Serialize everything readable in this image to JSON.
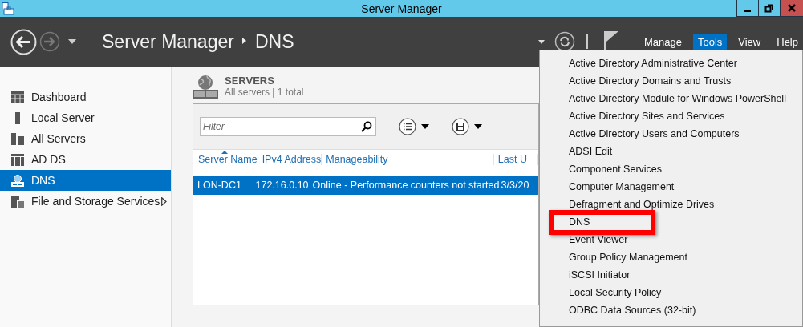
{
  "window": {
    "title": "Server Manager"
  },
  "header": {
    "breadcrumb": [
      {
        "label": "Server Manager"
      },
      {
        "label": "DNS"
      }
    ],
    "menus": [
      {
        "label": "Manage",
        "selected": false
      },
      {
        "label": "Tools",
        "selected": true
      },
      {
        "label": "View",
        "selected": false
      },
      {
        "label": "Help",
        "selected": false
      }
    ]
  },
  "sidebar": {
    "items": [
      {
        "label": "Dashboard",
        "selected": false,
        "has_submenu": false
      },
      {
        "label": "Local Server",
        "selected": false,
        "has_submenu": false
      },
      {
        "label": "All Servers",
        "selected": false,
        "has_submenu": false
      },
      {
        "label": "AD DS",
        "selected": false,
        "has_submenu": false
      },
      {
        "label": "DNS",
        "selected": true,
        "has_submenu": false
      },
      {
        "label": "File and Storage Services",
        "selected": false,
        "has_submenu": true
      }
    ]
  },
  "servers": {
    "title": "SERVERS",
    "subtitle": "All servers | 1 total",
    "filter": {
      "placeholder": "Filter"
    },
    "table": {
      "columns": [
        "Server Name",
        "IPv4 Address",
        "Manageability",
        "Last U"
      ],
      "rows": [
        {
          "cells": [
            "LON-DC1",
            "172.16.0.10",
            "Online - Performance counters not started",
            "3/3/20"
          ],
          "selected": true
        }
      ]
    }
  },
  "tools_menu": {
    "items": [
      {
        "label": "Active Directory Administrative Center",
        "highlighted": false
      },
      {
        "label": "Active Directory Domains and Trusts",
        "highlighted": false
      },
      {
        "label": "Active Directory Module for Windows PowerShell",
        "highlighted": false
      },
      {
        "label": "Active Directory Sites and Services",
        "highlighted": false
      },
      {
        "label": "Active Directory Users and Computers",
        "highlighted": false
      },
      {
        "label": "ADSI Edit",
        "highlighted": false
      },
      {
        "label": "Component Services",
        "highlighted": false
      },
      {
        "label": "Computer Management",
        "highlighted": false
      },
      {
        "label": "Defragment and Optimize Drives",
        "highlighted": false
      },
      {
        "label": "DNS",
        "highlighted": true
      },
      {
        "label": "Event Viewer",
        "highlighted": false
      },
      {
        "label": "Group Policy Management",
        "highlighted": false
      },
      {
        "label": "iSCSI Initiator",
        "highlighted": false
      },
      {
        "label": "Local Security Policy",
        "highlighted": false
      },
      {
        "label": "ODBC Data Sources (32-bit)",
        "highlighted": false
      }
    ]
  }
}
